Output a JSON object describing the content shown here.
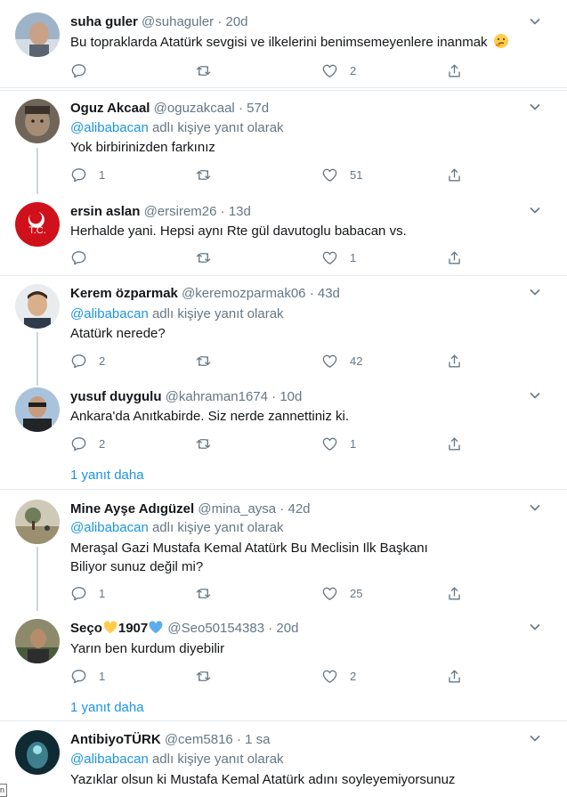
{
  "tweets": [
    {
      "name": "suha guler",
      "handle": "@suhaguler",
      "time": "20d",
      "text": "Bu topraklarda Atatürk sevgisi ve ilkelerini benimsemeyenlere inanmak",
      "text_emoji": "thinking-face",
      "replies": "",
      "likes": "2"
    },
    {
      "name": "Oguz Akcaal",
      "handle": "@oguzakcaal",
      "time": "57d",
      "reply_mention": "@alibabacan",
      "reply_suffix": " adlı kişiye yanıt olarak",
      "text": "Yok birbirinizden farkınız",
      "replies": "1",
      "likes": "51"
    },
    {
      "name": "ersin aslan",
      "handle": "@ersirem26",
      "time": "13d",
      "text": "Herhalde yani. Hepsi aynı Rte gül davutoglu babacan vs.",
      "replies": "",
      "likes": "1",
      "avatar_text": "T.C."
    },
    {
      "name": "Kerem özparmak",
      "handle": "@keremozparmak06",
      "time": "43d",
      "reply_mention": "@alibabacan",
      "reply_suffix": " adlı kişiye yanıt olarak",
      "text": "Atatürk nerede?",
      "replies": "2",
      "likes": "42"
    },
    {
      "name": "yusuf duygulu",
      "handle": "@kahraman1674",
      "time": "10d",
      "text": "Ankara'da Anıtkabirde. Siz nerde zannettiniz ki.",
      "replies": "2",
      "likes": "1",
      "more": "1 yanıt daha"
    },
    {
      "name": "Mine Ayşe Adıgüzel",
      "handle": "@mina_aysa",
      "time": "42d",
      "reply_mention": "@alibabacan",
      "reply_suffix": " adlı kişiye yanıt olarak",
      "text": "Meraşal Gazi Mustafa Kemal Atatürk Bu Meclisin Ilk Başkanı",
      "text2": "Biliyor sunuz değil mi?",
      "replies": "1",
      "likes": "25"
    },
    {
      "name_a": "Seço",
      "name_b": "1907",
      "handle": "@Seo50154383",
      "time": "20d",
      "text": "Yarın ben kurdum diyebilir",
      "replies": "1",
      "likes": "2",
      "more": "1 yanıt daha"
    },
    {
      "name": "AntibiyoTÜRK",
      "handle": "@cem5816",
      "time": "1 sa",
      "reply_mention": "@alibabacan",
      "reply_suffix": " adlı kişiye yanıt olarak",
      "text": "Yazıklar olsun ki Mustafa Kemal Atatürk adını soyleyemiyorsunuz"
    }
  ],
  "dot": "·",
  "corner_char": "n",
  "icons": {
    "reply": "reply-icon",
    "retweet": "retweet-icon",
    "like": "like-icon",
    "share": "share-icon",
    "caret": "chevron-down-icon"
  },
  "colors": {
    "text": "#14171a",
    "muted": "#657786",
    "link": "#1b95e0",
    "divider": "#e6ecf0",
    "thread": "#ccd6dd",
    "heart_yellow": "#ffcc4d",
    "heart_blue": "#5dadec"
  }
}
